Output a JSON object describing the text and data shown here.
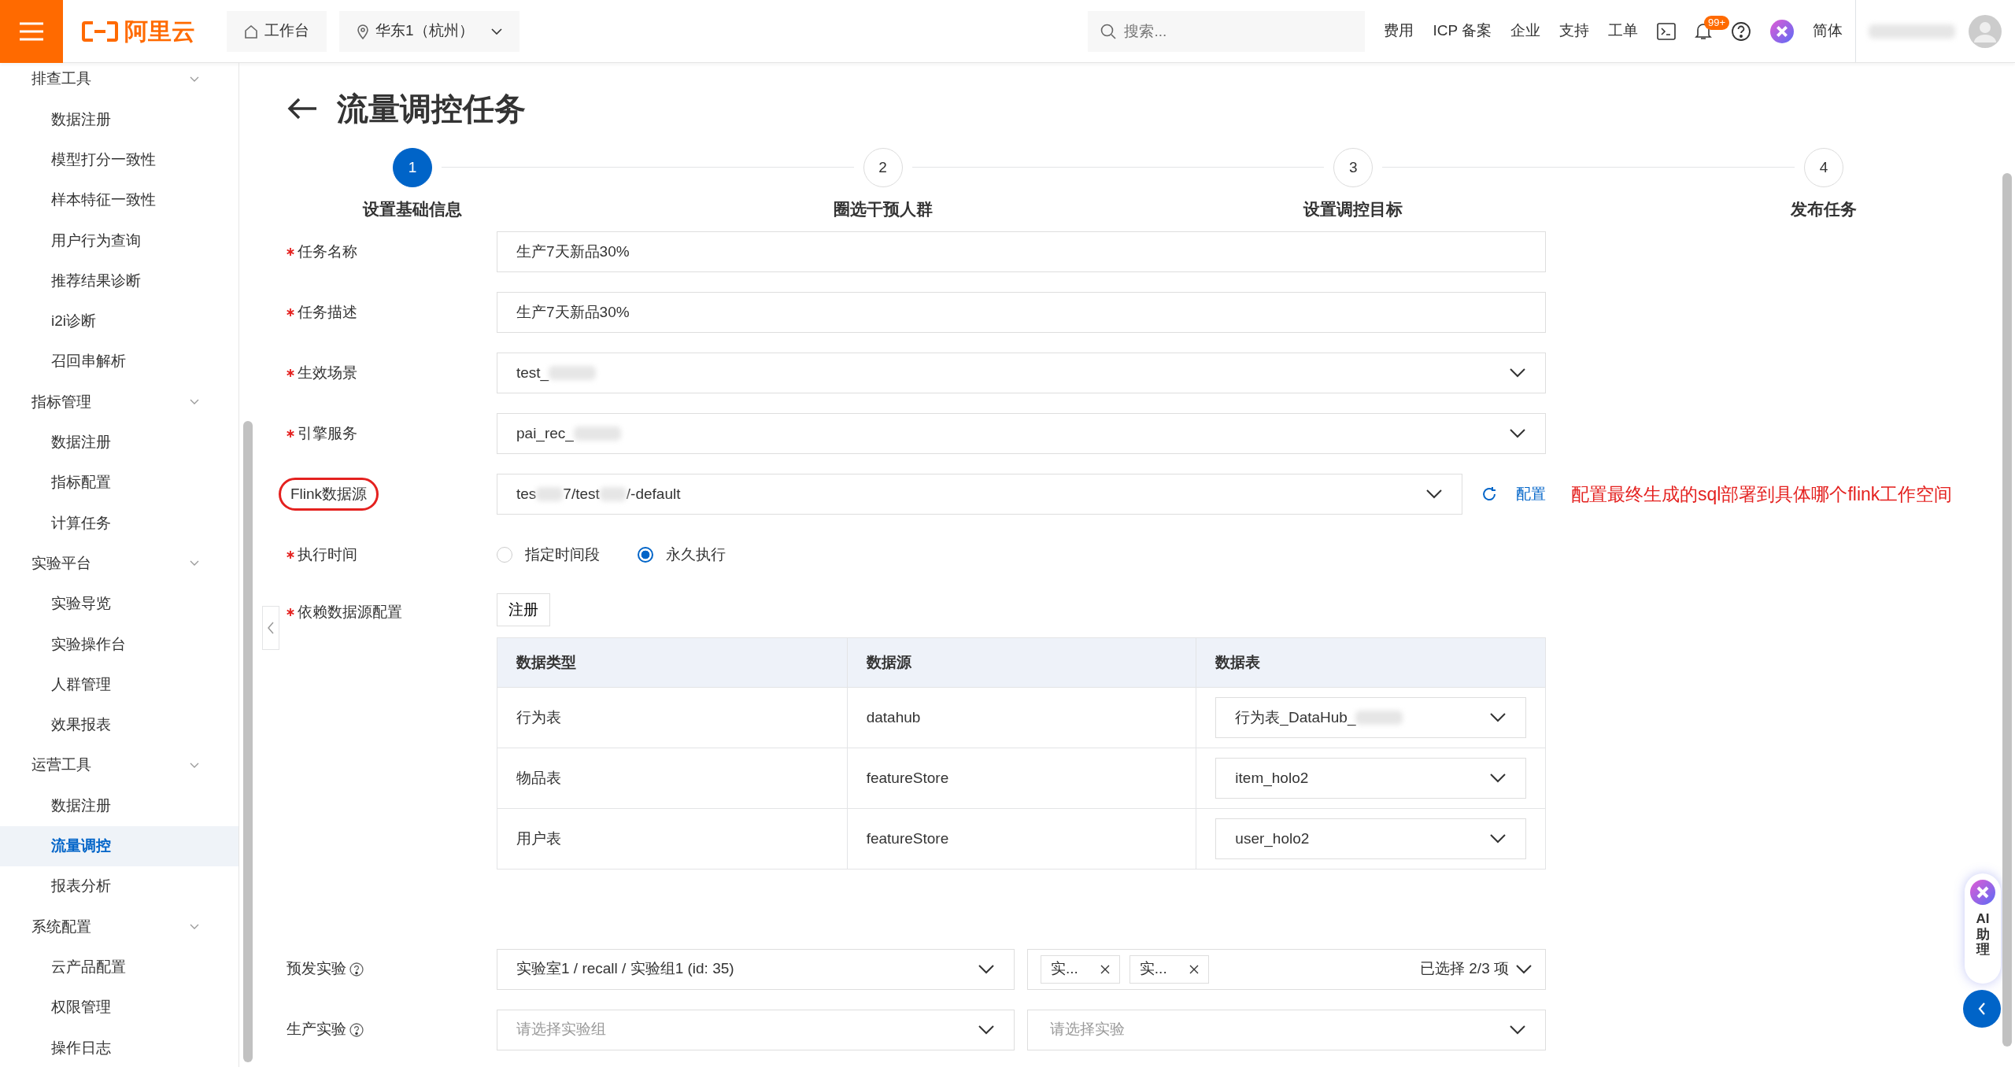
{
  "topbar": {
    "logo": "阿里云",
    "workbench": "工作台",
    "region": "华东1（杭州）",
    "search": {
      "placeholder": "搜索..."
    },
    "links": [
      "费用",
      "ICP 备案",
      "企业",
      "支持",
      "工单"
    ],
    "notifications": "99+",
    "language": "简体"
  },
  "sidebar": {
    "groups": [
      {
        "label": "排查工具",
        "expanded": true,
        "items": [
          {
            "label": "数据注册",
            "selected": false
          },
          {
            "label": "模型打分一致性",
            "selected": false
          },
          {
            "label": "样本特征一致性",
            "selected": false
          },
          {
            "label": "用户行为查询",
            "selected": false
          },
          {
            "label": "推荐结果诊断",
            "selected": false
          },
          {
            "label": "i2i诊断",
            "selected": false
          },
          {
            "label": "召回串解析",
            "selected": false
          }
        ]
      },
      {
        "label": "指标管理",
        "expanded": true,
        "items": [
          {
            "label": "数据注册",
            "selected": false
          },
          {
            "label": "指标配置",
            "selected": false
          },
          {
            "label": "计算任务",
            "selected": false
          }
        ]
      },
      {
        "label": "实验平台",
        "expanded": true,
        "items": [
          {
            "label": "实验导览",
            "selected": false
          },
          {
            "label": "实验操作台",
            "selected": false
          },
          {
            "label": "人群管理",
            "selected": false
          },
          {
            "label": "效果报表",
            "selected": false
          }
        ]
      },
      {
        "label": "运营工具",
        "expanded": true,
        "items": [
          {
            "label": "数据注册",
            "selected": false
          },
          {
            "label": "流量调控",
            "selected": true
          },
          {
            "label": "报表分析",
            "selected": false
          }
        ]
      },
      {
        "label": "系统配置",
        "expanded": true,
        "items": [
          {
            "label": "云产品配置",
            "selected": false
          },
          {
            "label": "权限管理",
            "selected": false
          },
          {
            "label": "操作日志",
            "selected": false
          }
        ]
      }
    ]
  },
  "page": {
    "title": "流量调控任务"
  },
  "steps": [
    {
      "number": "1",
      "label": "设置基础信息",
      "selected": true
    },
    {
      "number": "2",
      "label": "圈选干预人群",
      "selected": false
    },
    {
      "number": "3",
      "label": "设置调控目标",
      "selected": false
    },
    {
      "number": "4",
      "label": "发布任务",
      "selected": false
    }
  ],
  "form": {
    "fields": [
      {
        "kind": "text",
        "label": "任务名称",
        "required": true,
        "value": [
          "生产7天新品30%"
        ]
      },
      {
        "kind": "text",
        "label": "任务描述",
        "required": true,
        "value": [
          "生产7天新品30%"
        ]
      },
      {
        "kind": "select",
        "label": "生效场景",
        "required": true,
        "value": [
          "test_"
        ],
        "blurred_end": true
      },
      {
        "kind": "select",
        "label": "引擎服务",
        "required": true,
        "value": [
          "pai_rec_"
        ],
        "blurred_end": true
      },
      {
        "kind": "select",
        "label": "Flink数据源",
        "required": false,
        "highlighted": true,
        "value": [
          "tes",
          "7/test",
          "/-default"
        ],
        "action": "配置",
        "note": "配置最终生成的sql部署到具体哪个flink工作空间"
      },
      {
        "kind": "radio",
        "label": "执行时间",
        "required": true,
        "options": [
          {
            "label": "指定时间段",
            "selected": false
          },
          {
            "label": "永久执行",
            "selected": true
          }
        ]
      },
      {
        "kind": "table",
        "label": "依赖数据源配置",
        "required": true,
        "button": "注册",
        "columns": [
          "数据类型",
          "数据源",
          "数据表"
        ],
        "rows": [
          {
            "type": "行为表",
            "source": "datahub",
            "table": [
              "行为表_DataHub_"
            ],
            "blurred_end": true
          },
          {
            "type": "物品表",
            "source": "featureStore",
            "table": [
              "item_holo2"
            ]
          },
          {
            "type": "用户表",
            "source": "featureStore",
            "table": [
              "user_holo2"
            ]
          }
        ]
      },
      {
        "kind": "experiment",
        "label": "预发实验",
        "required": false,
        "group": {
          "value": "实验室1 / recall / 实验组1 (id: 35)"
        },
        "experiments": {
          "tags": [
            "实...",
            "实..."
          ],
          "summary": "已选择 2/3 项"
        }
      },
      {
        "kind": "experiment",
        "label": "生产实验",
        "required": false,
        "group": {
          "placeholder": "请选择实验组"
        },
        "experiments": {
          "placeholder": "请选择实验"
        }
      }
    ]
  },
  "assistant": {
    "label": "AI助理"
  }
}
